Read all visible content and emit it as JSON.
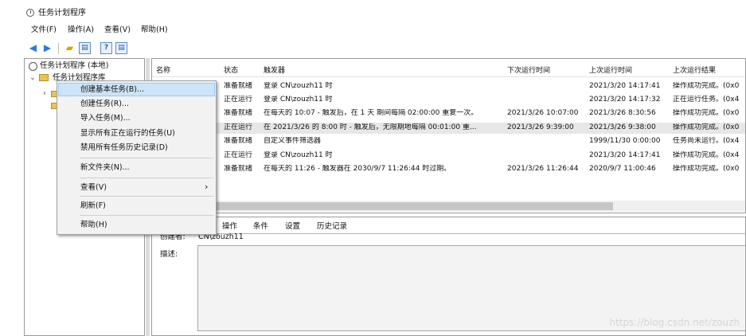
{
  "app": {
    "title": "任务计划程序"
  },
  "menu": [
    "文件(F)",
    "操作(A)",
    "查看(V)",
    "帮助(H)"
  ],
  "toolbar": {
    "back_icon": "arrow-left-icon",
    "forward_icon": "arrow-right-icon",
    "folder_icon": "folder-up-icon",
    "panel_icon": "console-panel-icon",
    "help_icon": "help-icon",
    "pane_icon": "action-pane-icon",
    "accent": "#2b7bd6"
  },
  "tree": {
    "root": "任务计划程序 (本地)",
    "library": "任务计划程序库"
  },
  "table": {
    "headers": [
      "名称",
      "状态",
      "触发器",
      "下次运行时间",
      "上次运行时间",
      "上次运行结果"
    ],
    "rows": [
      {
        "status": "准备就绪",
        "trigger": "登录 CN\\zouzh11 时",
        "next": "",
        "last": "2021/3/20 14:17:41",
        "result": "操作成功完成。(0x0"
      },
      {
        "status": "正在运行",
        "trigger": "登录 CN\\zouzh11 时",
        "next": "",
        "last": "2021/3/20 14:17:32",
        "result": "正在运行任务。(0x4"
      },
      {
        "status": "准备就绪",
        "trigger": "在每天的 10:07 - 触发后，在 1 天 期间每隔 02:00:00 重复一次。",
        "next": "2021/3/26 10:07:00",
        "last": "2021/3/26 8:30:56",
        "result": "操作成功完成。(0x0"
      },
      {
        "status": "正在运行",
        "trigger": "在 2021/3/26 的 8:00 时 - 触发后，无限期地每隔 00:01:00 重...",
        "next": "2021/3/26 9:39:00",
        "last": "2021/3/26 9:38:00",
        "result": "操作成功完成。(0x0"
      },
      {
        "status": "准备就绪",
        "trigger": "自定义事件筛选器",
        "next": "",
        "last": "1999/11/30 0:00:00",
        "result": "任务尚未运行。(0x4"
      },
      {
        "status": "正在运行",
        "trigger": "登录 CN\\zouzh11 时",
        "next": "",
        "last": "2021/3/20 14:17:41",
        "result": "操作成功完成。(0x4"
      },
      {
        "status": "准备就绪",
        "trigger": "在每天的 11:26 - 触发器在 2030/9/7 11:26:44 时过期。",
        "next": "2021/3/26 11:26:44",
        "last": "2020/9/7 11:00:46",
        "result": "操作成功完成。(0x0"
      }
    ]
  },
  "details": {
    "tabs": [
      "操作",
      "条件",
      "设置",
      "历史记录"
    ],
    "creator_label": "创建者:",
    "creator_value": "CN\\zouzh11",
    "desc_label": "描述:"
  },
  "context_menu": {
    "items": [
      {
        "label": "创建基本任务(B)..."
      },
      {
        "label": "创建任务(R)..."
      },
      {
        "label": "导入任务(M)..."
      },
      {
        "label": "显示所有正在运行的任务(U)"
      },
      {
        "label": "禁用所有任务历史记录(D)"
      },
      {
        "label": "新文件夹(N)..."
      },
      {
        "label": "查看(V)"
      },
      {
        "label": "刷新(F)"
      },
      {
        "label": "帮助(H)"
      }
    ],
    "submenu_arrow": "›"
  },
  "watermark": "https://blog.csdn.net/zouzh"
}
